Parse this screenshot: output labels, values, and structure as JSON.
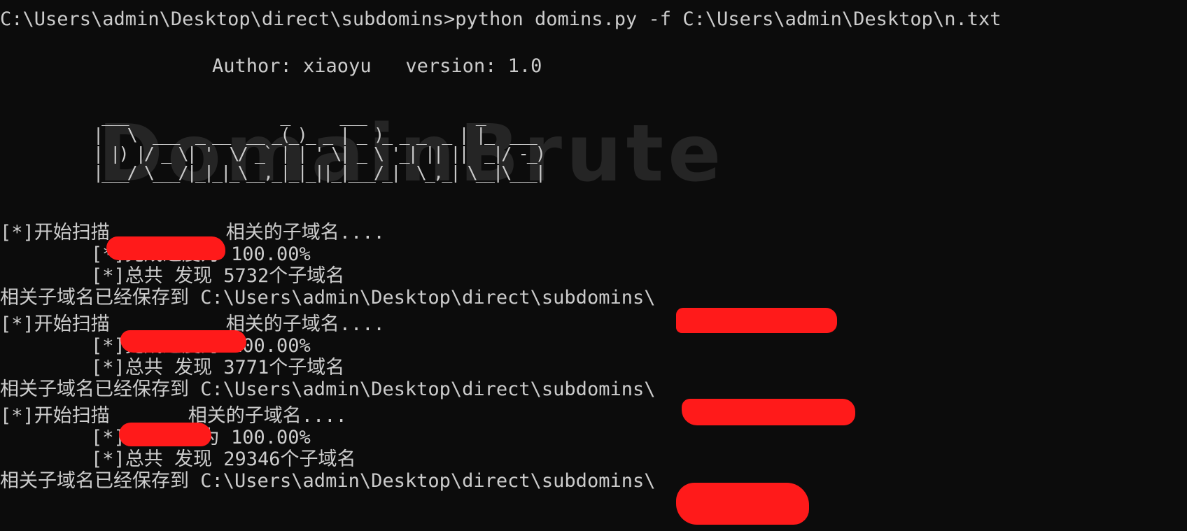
{
  "terminal": {
    "command_line": "C:\\Users\\admin\\Desktop\\direct\\subdomins>python domins.py -f C:\\Users\\admin\\Desktop\\n.txt",
    "author_line": "Author: xiaoyu   version: 1.0",
    "banner_ghost": "DomainBrute",
    "banner_art": " ___                  _      ___             _\n|   \\  ___  _ __  __ _(_)_ _ | _ )_ _ _  _ | |_  ___\n| |) |/ _ \\| '  \\/ _` | | ' \\| _ \\ '_| || ||  _|/ -_)\n|___/ \\___/|_|_|_\\__,_|_|_||_|___/_|  \\_,_| \\__|\\___|",
    "blocks": [
      {
        "start_prefix": "[*]开始扫描",
        "start_suffix": "相关的子域名....",
        "progress": "[*]完成进度为 100.00%",
        "total": "[*]总共 发现 5732个子域名",
        "saved": "相关子域名已经保存到 C:\\Users\\admin\\Desktop\\direct\\subdomins\\"
      },
      {
        "start_prefix": "[*]开始扫描",
        "start_suffix": "相关的子域名....",
        "progress": "[*]完成进度为 100.00%",
        "total": "[*]总共 发现 3771个子域名",
        "saved": "相关子域名已经保存到 C:\\Users\\admin\\Desktop\\direct\\subdomins\\"
      },
      {
        "start_prefix": "[*]开始扫描",
        "start_suffix": "相关的子域名....",
        "progress": "[*]完成进度为 100.00%",
        "total": "[*]总共 发现 29346个子域名",
        "saved": "相关子域名已经保存到 C:\\Users\\admin\\Desktop\\direct\\subdomins\\"
      }
    ]
  },
  "colors": {
    "background": "#0c0c0c",
    "text": "#cccccc",
    "redaction": "#ff1a1a"
  }
}
